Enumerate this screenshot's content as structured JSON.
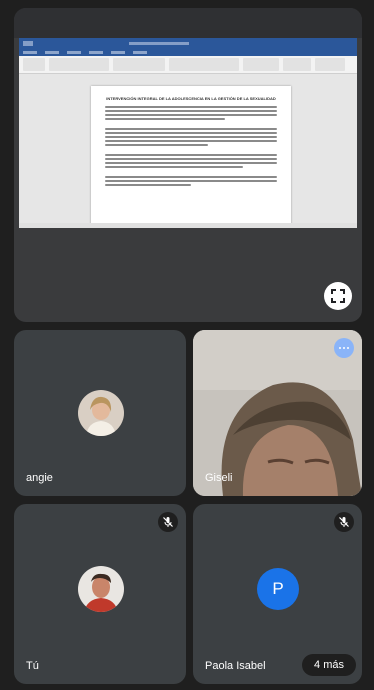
{
  "shared_document": {
    "title": "INTERVENCIÓN INTEGRAL DE LA ADOLESCENCIA EN LA GESTIÓN DE LA SEXUALIDAD"
  },
  "participants": [
    {
      "name": "angie",
      "muted": false
    },
    {
      "name": "Giseli",
      "muted": false
    },
    {
      "name": "Tú",
      "muted": true
    },
    {
      "name": "Paola Isabel",
      "initial": "P",
      "muted": true
    }
  ],
  "more_participants_label": "4 más",
  "colors": {
    "background": "#1f1f1f",
    "tile": "#3c4043",
    "avatar_blue": "#1a73e8",
    "options_blue": "#8ab4f8"
  },
  "icons": {
    "fullscreen": "fullscreen-icon",
    "mic_off": "mic-off-icon",
    "more": "more-horizontal-icon"
  }
}
